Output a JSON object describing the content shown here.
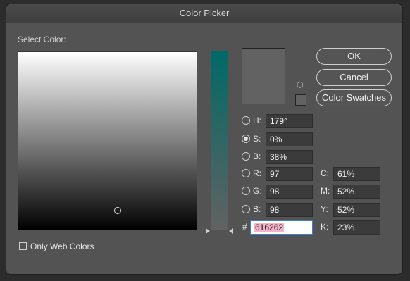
{
  "window": {
    "title": "Color Picker"
  },
  "field": {
    "label": "Select Color:"
  },
  "buttons": {
    "ok": "OK",
    "cancel": "Cancel",
    "swatches": "Color Swatches"
  },
  "hsb": [
    {
      "label": "H:",
      "value": "179°",
      "selected": false
    },
    {
      "label": "S:",
      "value": "0%",
      "selected": true
    },
    {
      "label": "B:",
      "value": "38%",
      "selected": false
    }
  ],
  "rgb": [
    {
      "label": "R:",
      "value": "97",
      "selected": false
    },
    {
      "label": "G:",
      "value": "98",
      "selected": false
    },
    {
      "label": "B:",
      "value": "98",
      "selected": false
    }
  ],
  "cmyk": [
    {
      "label": "C:",
      "value": "61%"
    },
    {
      "label": "M:",
      "value": "52%"
    },
    {
      "label": "Y:",
      "value": "52%"
    },
    {
      "label": "K:",
      "value": "23%"
    }
  ],
  "hex": {
    "label": "#",
    "value": "616262"
  },
  "web_only": {
    "label": "Only Web Colors",
    "checked": false
  },
  "colors": {
    "current": "#626262",
    "hue_top": "#006a66"
  },
  "icons": {
    "gamut": "cube-icon"
  }
}
